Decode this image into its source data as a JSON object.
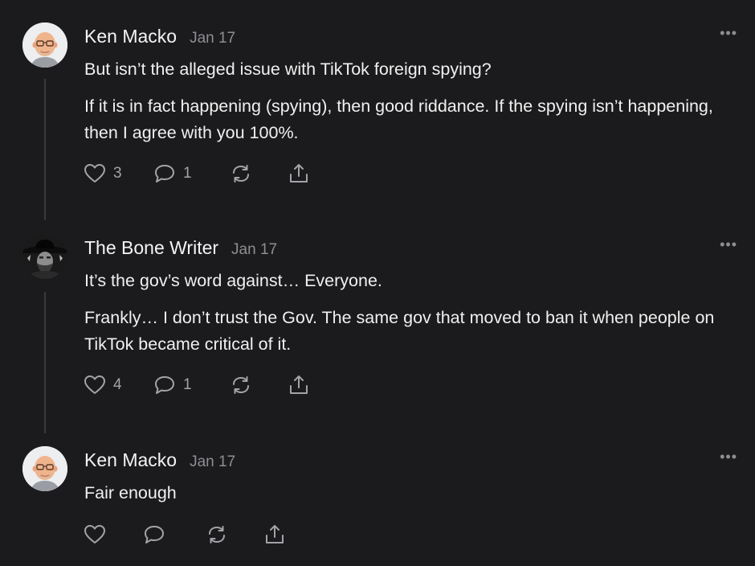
{
  "comments": [
    {
      "author": "Ken Macko",
      "date": "Jan 17",
      "paragraphs": [
        "But isn’t the alleged issue with TikTok foreign spying?",
        "If it is in fact happening (spying), then good riddance. If the spying isn’t happening, then I agree with you 100%."
      ],
      "likes": "3",
      "replies": "1"
    },
    {
      "author": "The Bone Writer",
      "date": "Jan 17",
      "paragraphs": [
        "It’s the gov’s word against… Everyone.",
        "Frankly… I don’t trust the Gov. The same gov that moved to ban it when people on TikTok became critical of it."
      ],
      "likes": "4",
      "replies": "1"
    },
    {
      "author": "Ken Macko",
      "date": "Jan 17",
      "paragraphs": [
        "Fair enough"
      ],
      "likes": "",
      "replies": ""
    }
  ],
  "more_label": "•••",
  "icons": {
    "like": "heart-icon",
    "reply": "speech-bubble-icon",
    "restack": "restack-icon",
    "share": "share-icon",
    "more": "ellipsis-icon"
  },
  "colors": {
    "background": "#1b1b1d",
    "text": "#f0f0f0",
    "muted": "#8e8e93"
  }
}
